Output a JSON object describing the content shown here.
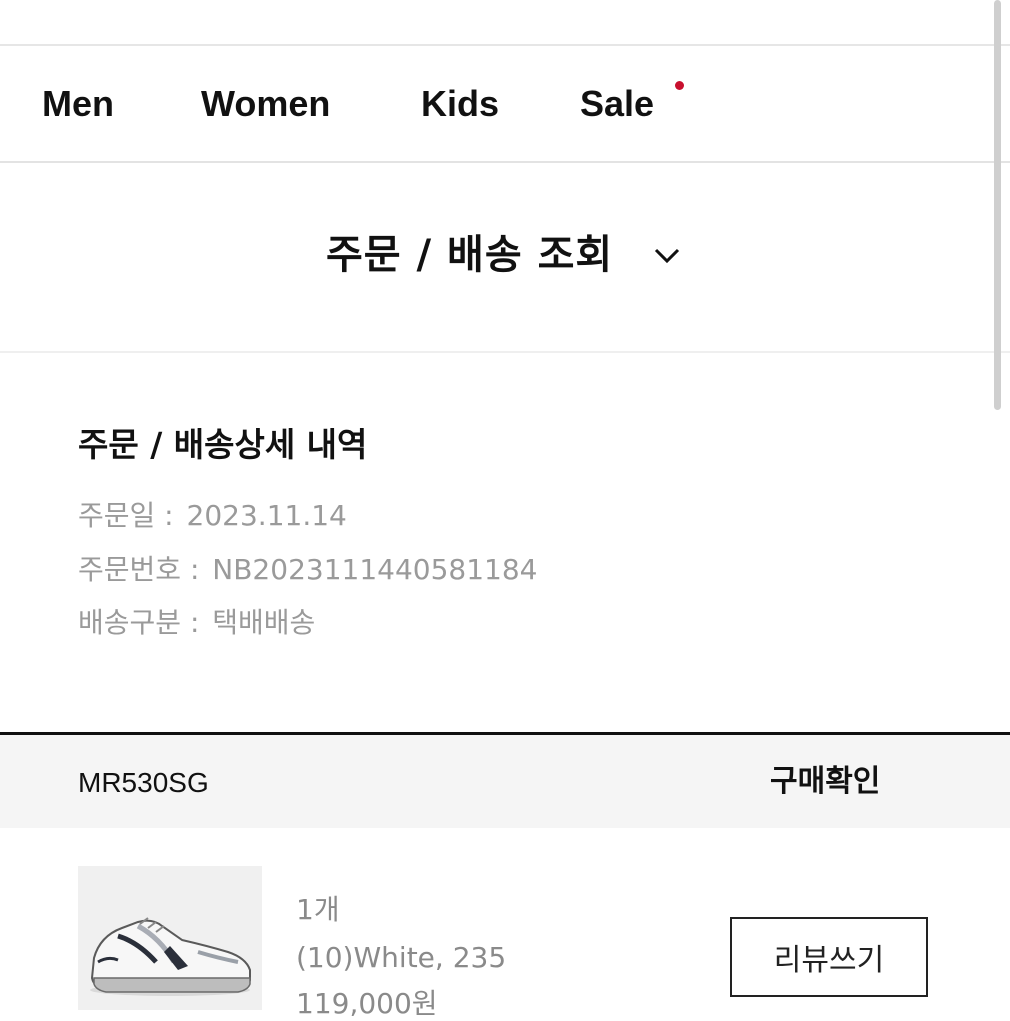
{
  "nav": {
    "items": [
      {
        "label": "Men"
      },
      {
        "label": "Women"
      },
      {
        "label": "Kids"
      },
      {
        "label": "Sale"
      }
    ],
    "sale_dot_color": "#c8102e"
  },
  "page": {
    "title": "주문 / 배송 조회",
    "chevron_icon": "chevron-down-icon"
  },
  "order_detail": {
    "title": "주문 / 배송상세 내역",
    "date_label": "주문일 :",
    "date_value": "2023.11.14",
    "number_label": "주문번호 :",
    "number_value": "NB2023111440581184",
    "shipping_label": "배송구분 :",
    "shipping_value": "택배배송"
  },
  "order_item": {
    "model": "MR530SG",
    "status": "구매확인",
    "quantity": "1개",
    "option": "(10)White, 235",
    "price": "119,000원",
    "review_button": "리뷰쓰기"
  }
}
